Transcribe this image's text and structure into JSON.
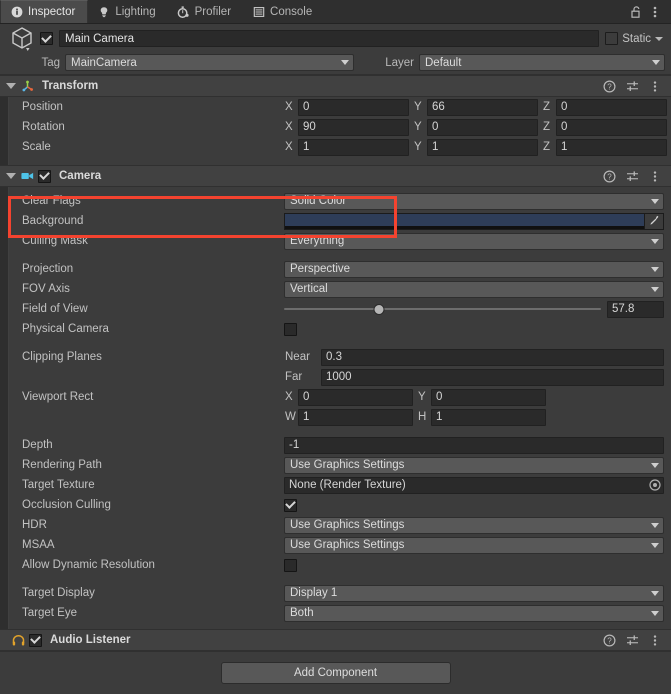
{
  "window": {
    "tabs": [
      {
        "label": "Inspector",
        "icon": "info-icon",
        "active": true
      },
      {
        "label": "Lighting",
        "icon": "lightbulb-icon",
        "active": false
      },
      {
        "label": "Profiler",
        "icon": "stopwatch-icon",
        "active": false
      },
      {
        "label": "Console",
        "icon": "console-icon",
        "active": false
      }
    ],
    "lock_icon": "padlock-open-icon",
    "menu_icon": "vertical-ellipsis-icon"
  },
  "object_header": {
    "icon": "cube-prefab-icon",
    "enabled": true,
    "name": "Main Camera",
    "static_label": "Static",
    "static_checked": false,
    "tag_label": "Tag",
    "tag_value": "MainCamera",
    "layer_label": "Layer",
    "layer_value": "Default"
  },
  "transform": {
    "title": "Transform",
    "icon": "transform-axis-icon",
    "rows": [
      {
        "label": "Position",
        "x": "0",
        "y": "66",
        "z": "0"
      },
      {
        "label": "Rotation",
        "x": "90",
        "y": "0",
        "z": "0"
      },
      {
        "label": "Scale",
        "x": "1",
        "y": "1",
        "z": "1"
      }
    ],
    "axis_labels": {
      "x": "X",
      "y": "Y",
      "z": "Z"
    }
  },
  "camera": {
    "title": "Camera",
    "icon": "camera-icon",
    "enabled": true,
    "clear_flags": {
      "label": "Clear Flags",
      "value": "Solid Color"
    },
    "background": {
      "label": "Background",
      "color": "#2e3d58",
      "eyedropper_icon": "eyedropper-icon"
    },
    "culling_mask": {
      "label": "Culling Mask",
      "value": "Everything"
    },
    "projection": {
      "label": "Projection",
      "value": "Perspective"
    },
    "fov_axis": {
      "label": "FOV Axis",
      "value": "Vertical"
    },
    "field_of_view": {
      "label": "Field of View",
      "value": "57.8",
      "slider_percent": 30
    },
    "physical_camera": {
      "label": "Physical Camera",
      "checked": false
    },
    "clipping_planes": {
      "label": "Clipping Planes",
      "near_label": "Near",
      "near_value": "0.3",
      "far_label": "Far",
      "far_value": "1000"
    },
    "viewport_rect": {
      "label": "Viewport Rect",
      "x_label": "X",
      "x_value": "0",
      "y_label": "Y",
      "y_value": "0",
      "w_label": "W",
      "w_value": "1",
      "h_label": "H",
      "h_value": "1"
    },
    "depth": {
      "label": "Depth",
      "value": "-1"
    },
    "rendering_path": {
      "label": "Rendering Path",
      "value": "Use Graphics Settings"
    },
    "target_texture": {
      "label": "Target Texture",
      "value": "None (Render Texture)",
      "picker_icon": "object-picker-icon"
    },
    "occlusion_culling": {
      "label": "Occlusion Culling",
      "checked": true
    },
    "hdr": {
      "label": "HDR",
      "value": "Use Graphics Settings"
    },
    "msaa": {
      "label": "MSAA",
      "value": "Use Graphics Settings"
    },
    "allow_dynamic_resolution": {
      "label": "Allow Dynamic Resolution",
      "checked": false
    },
    "target_display": {
      "label": "Target Display",
      "value": "Display 1"
    },
    "target_eye": {
      "label": "Target Eye",
      "value": "Both"
    }
  },
  "audio_listener": {
    "title": "Audio Listener",
    "icon": "headphones-icon",
    "enabled": true
  },
  "component_icons": {
    "help": "help-icon",
    "preset": "preset-sliders-icon",
    "menu": "vertical-ellipsis-icon"
  },
  "add_component": {
    "label": "Add Component"
  },
  "highlight": {
    "color": "#f4432f"
  }
}
